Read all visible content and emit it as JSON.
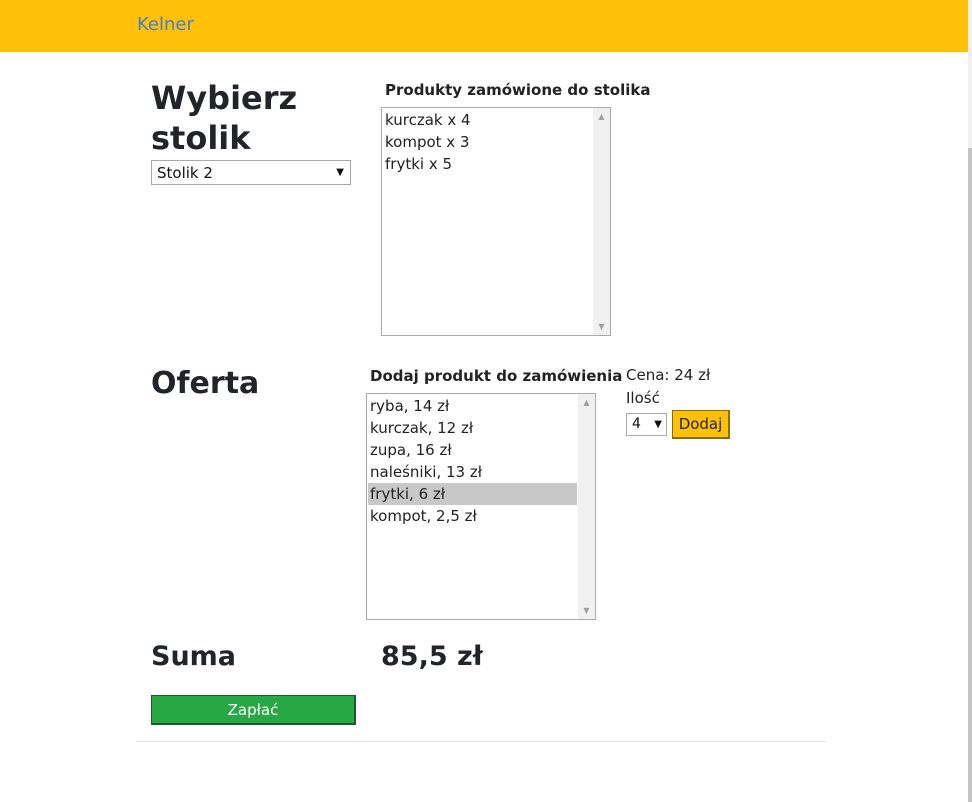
{
  "navbar": {
    "brand": "Kelner"
  },
  "table_section": {
    "heading": "Wybierz stolik",
    "selected_table": "Stolik 2",
    "ordered_label": "Produkty zamówione do stolika",
    "ordered_items": [
      "kurczak x 4",
      "kompot x 3",
      "frytki x 5"
    ]
  },
  "offer_section": {
    "heading": "Oferta",
    "add_label": "Dodaj produkt do zamówienia",
    "products": [
      "ryba, 14 zł",
      "kurczak, 12 zł",
      "zupa, 16 zł",
      "naleśniki, 13 zł",
      "frytki, 6 zł",
      "kompot, 2,5 zł"
    ],
    "selected_product": "frytki, 6 zł",
    "price_text": "Cena: 24 zł",
    "quantity_label": "Ilość",
    "quantity_value": "4",
    "add_button": "Dodaj"
  },
  "sum_section": {
    "heading": "Suma",
    "value": "85,5 zł",
    "pay_button": "Zapłać"
  },
  "colors": {
    "navbar": "#ffc107",
    "brand_link": "#4a7ec9",
    "pay_button": "#28a745",
    "add_button": "#ffc107",
    "selected_row": "#c8c8c8"
  },
  "icons": [
    "dropdown-arrow-icon",
    "scroll-up-arrow-icon",
    "scroll-down-arrow-icon"
  ]
}
